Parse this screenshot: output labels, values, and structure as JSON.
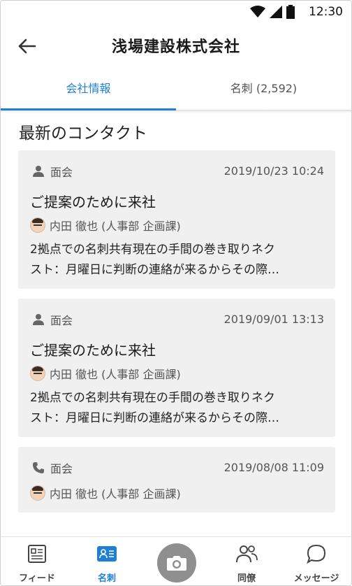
{
  "status_bar": {
    "time": "12:30",
    "icons": [
      "wifi-icon",
      "signal-icon",
      "battery-icon"
    ]
  },
  "header": {
    "title": "浅場建設株式会社",
    "back_icon": "arrow-left-icon"
  },
  "tabs": [
    {
      "label": "会社情報",
      "active": true
    },
    {
      "label": "名刺 (2,592)",
      "active": false
    }
  ],
  "section": {
    "title": "最新のコンタクト"
  },
  "contacts": [
    {
      "type_icon": "person-icon",
      "type": "面会",
      "datetime": "2019/10/23 10:24",
      "title": "ご提案のために来社",
      "person": "内田 徹也 (人事部 企画課)",
      "snippet_line1": "2拠点での名刺共有現在の手間の巻き取りネク",
      "snippet_line2": "スト：月曜日に判断の連絡が来るからその際…"
    },
    {
      "type_icon": "person-icon",
      "type": "面会",
      "datetime": "2019/09/01 13:13",
      "title": "ご提案のために来社",
      "person": "内田 徹也 (人事部 企画課)",
      "snippet_line1": "2拠点での名刺共有現在の手間の巻き取りネク",
      "snippet_line2": "スト：月曜日に判断の連絡が来るからその際…"
    },
    {
      "type_icon": "phone-icon",
      "type": "面会",
      "datetime": "2019/08/08 11:09",
      "person": "内田 徹也 (人事部 企画課)"
    }
  ],
  "bottom_nav": [
    {
      "label": "フィード",
      "icon": "feed-icon",
      "active": false
    },
    {
      "label": "名刺",
      "icon": "business-card-icon",
      "active": true
    },
    {
      "label": "",
      "icon": "camera-icon",
      "active": false
    },
    {
      "label": "同僚",
      "icon": "colleagues-icon",
      "active": false
    },
    {
      "label": "メッセージ",
      "icon": "message-icon",
      "active": false
    }
  ],
  "colors": {
    "accent": "#1e7fd4",
    "card_bg": "#f0f0f0",
    "camera_bg": "#8f8f8f"
  }
}
